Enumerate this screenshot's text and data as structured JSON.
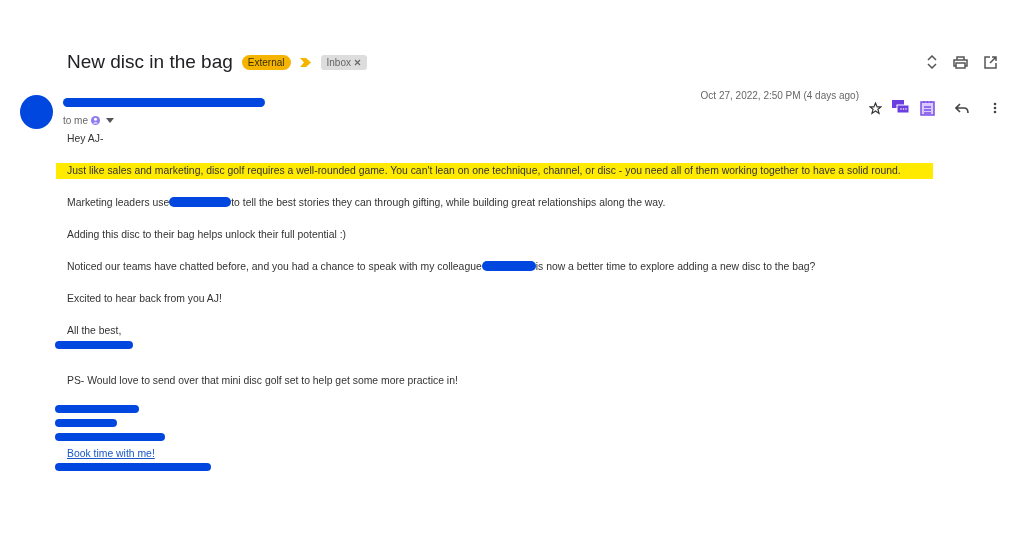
{
  "subject": "New disc in the bag",
  "labels": [
    {
      "text": "External",
      "kind": "warning"
    },
    {
      "text": "Inbox",
      "kind": "folder"
    }
  ],
  "message": {
    "recipient": "to me",
    "date": "Oct 27, 2022, 2:50 PM (4 days ago)",
    "starred": false
  },
  "body": [
    {
      "kind": "paragraph",
      "highlighted": false,
      "segments": [
        {
          "kind": "text",
          "text": "Hey AJ-"
        }
      ]
    },
    {
      "kind": "paragraph",
      "highlighted": true,
      "segments": [
        {
          "kind": "text",
          "text": "Just like sales and marketing, disc golf requires a well-rounded game. You can't lean on one technique, channel, or disc - you need all of them working together to have a solid round."
        }
      ]
    },
    {
      "kind": "paragraph",
      "highlighted": false,
      "segments": [
        {
          "kind": "text",
          "text": "Marketing leaders use"
        },
        {
          "kind": "redaction"
        },
        {
          "kind": "text",
          "text": "to tell the best stories they can through gifting, while building great relationships along the way."
        }
      ]
    },
    {
      "kind": "paragraph",
      "highlighted": false,
      "segments": [
        {
          "kind": "text",
          "text": "Adding this disc to their bag helps unlock their full potential :)"
        }
      ]
    },
    {
      "kind": "paragraph",
      "highlighted": false,
      "segments": [
        {
          "kind": "text",
          "text": "Noticed our teams have chatted before, and you had a chance to speak with my colleague"
        },
        {
          "kind": "redaction"
        },
        {
          "kind": "text",
          "text": "is now a better time to explore adding a new disc to the bag?"
        }
      ]
    },
    {
      "kind": "paragraph",
      "highlighted": false,
      "segments": [
        {
          "kind": "text",
          "text": "Excited to hear back from you AJ!"
        }
      ]
    },
    {
      "kind": "closing",
      "text": "All the best,"
    },
    {
      "kind": "redaction"
    },
    {
      "kind": "paragraph",
      "highlighted": false,
      "segments": [
        {
          "kind": "text",
          "text": "PS- Would love to send over that mini disc golf set to help get some more practice in!"
        }
      ]
    },
    {
      "kind": "redaction"
    },
    {
      "kind": "redaction"
    },
    {
      "kind": "redaction"
    },
    {
      "kind": "link",
      "text": "Book time with me!"
    },
    {
      "kind": "redaction"
    }
  ]
}
